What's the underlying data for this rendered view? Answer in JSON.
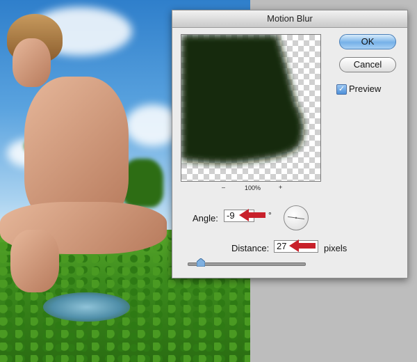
{
  "dialog": {
    "title": "Motion Blur",
    "ok_label": "OK",
    "cancel_label": "Cancel",
    "preview_label": "Preview",
    "preview_checked": true,
    "zoom_out": "–",
    "zoom_level": "100%",
    "zoom_in": "+",
    "angle_label": "Angle:",
    "angle_value": "-9",
    "degree_symbol": "°",
    "distance_label": "Distance:",
    "distance_value": "27",
    "pixels_label": "pixels",
    "distance_slider_fraction": 0.11
  },
  "colors": {
    "preview_fill": "#142b09",
    "annotation_arrow": "#c8202a",
    "ok_button": "#76b1e8"
  },
  "icons": {
    "check": "checkmark-icon",
    "arrow": "red-arrow-left-icon"
  }
}
